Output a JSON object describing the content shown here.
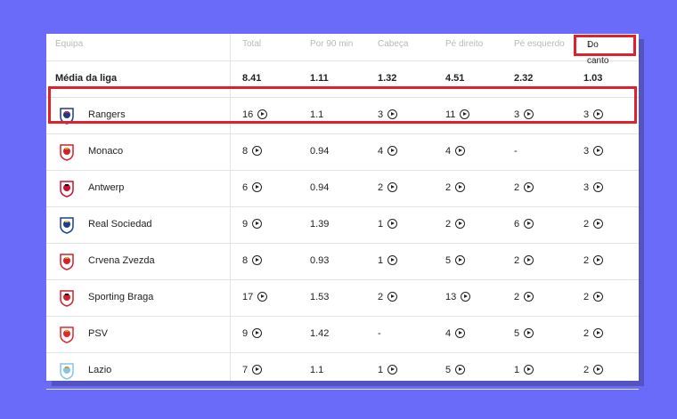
{
  "header": {
    "team": "Equipa",
    "total": "Total",
    "per90": "Por 90 min",
    "head": "Cabeça",
    "right_foot": "Pé direito",
    "left_foot": "Pé esquerdo",
    "corner": "Do canto"
  },
  "average": {
    "label": "Média da liga",
    "total": "8.41",
    "per90": "1.11",
    "head": "1.32",
    "right_foot": "4.51",
    "left_foot": "2.32",
    "corner": "1.03"
  },
  "rows": [
    {
      "name": "Rangers",
      "total": "16",
      "per90": "1.1",
      "head": "3",
      "right_foot": "11",
      "left_foot": "3",
      "corner": "3",
      "logo": "rangers-crest",
      "colors": [
        "#1b3a8c",
        "#ffffff",
        "#d62828"
      ]
    },
    {
      "name": "Monaco",
      "total": "8",
      "per90": "0.94",
      "head": "4",
      "right_foot": "4",
      "left_foot": "-",
      "corner": "3",
      "logo": "monaco-crest",
      "colors": [
        "#d4202a",
        "#ffffff",
        "#c9a227"
      ]
    },
    {
      "name": "Antwerp",
      "total": "6",
      "per90": "0.94",
      "head": "2",
      "right_foot": "2",
      "left_foot": "2",
      "corner": "3",
      "logo": "antwerp-crest",
      "colors": [
        "#c8102e",
        "#ffffff",
        "#111111"
      ]
    },
    {
      "name": "Real Sociedad",
      "total": "9",
      "per90": "1.39",
      "head": "1",
      "right_foot": "2",
      "left_foot": "6",
      "corner": "2",
      "logo": "real-sociedad-crest",
      "colors": [
        "#1b3f8b",
        "#ffffff",
        "#e8c24a"
      ]
    },
    {
      "name": "Crvena Zvezda",
      "total": "8",
      "per90": "0.93",
      "head": "1",
      "right_foot": "5",
      "left_foot": "2",
      "corner": "2",
      "logo": "crvena-zvezda-crest",
      "colors": [
        "#d4202a",
        "#ffffff",
        "#c9a227"
      ]
    },
    {
      "name": "Sporting Braga",
      "total": "17",
      "per90": "1.53",
      "head": "2",
      "right_foot": "13",
      "left_foot": "2",
      "corner": "2",
      "logo": "braga-crest",
      "colors": [
        "#d4202a",
        "#ffffff",
        "#111111"
      ]
    },
    {
      "name": "PSV",
      "total": "9",
      "per90": "1.42",
      "head": "-",
      "right_foot": "4",
      "left_foot": "5",
      "corner": "2",
      "logo": "psv-crest",
      "colors": [
        "#e3262f",
        "#ffffff",
        "#c9a227"
      ]
    },
    {
      "name": "Lazio",
      "total": "7",
      "per90": "1.1",
      "head": "1",
      "right_foot": "5",
      "left_foot": "1",
      "corner": "2",
      "logo": "lazio-crest",
      "colors": [
        "#87c3e8",
        "#ffffff",
        "#c9a227"
      ]
    }
  ]
}
